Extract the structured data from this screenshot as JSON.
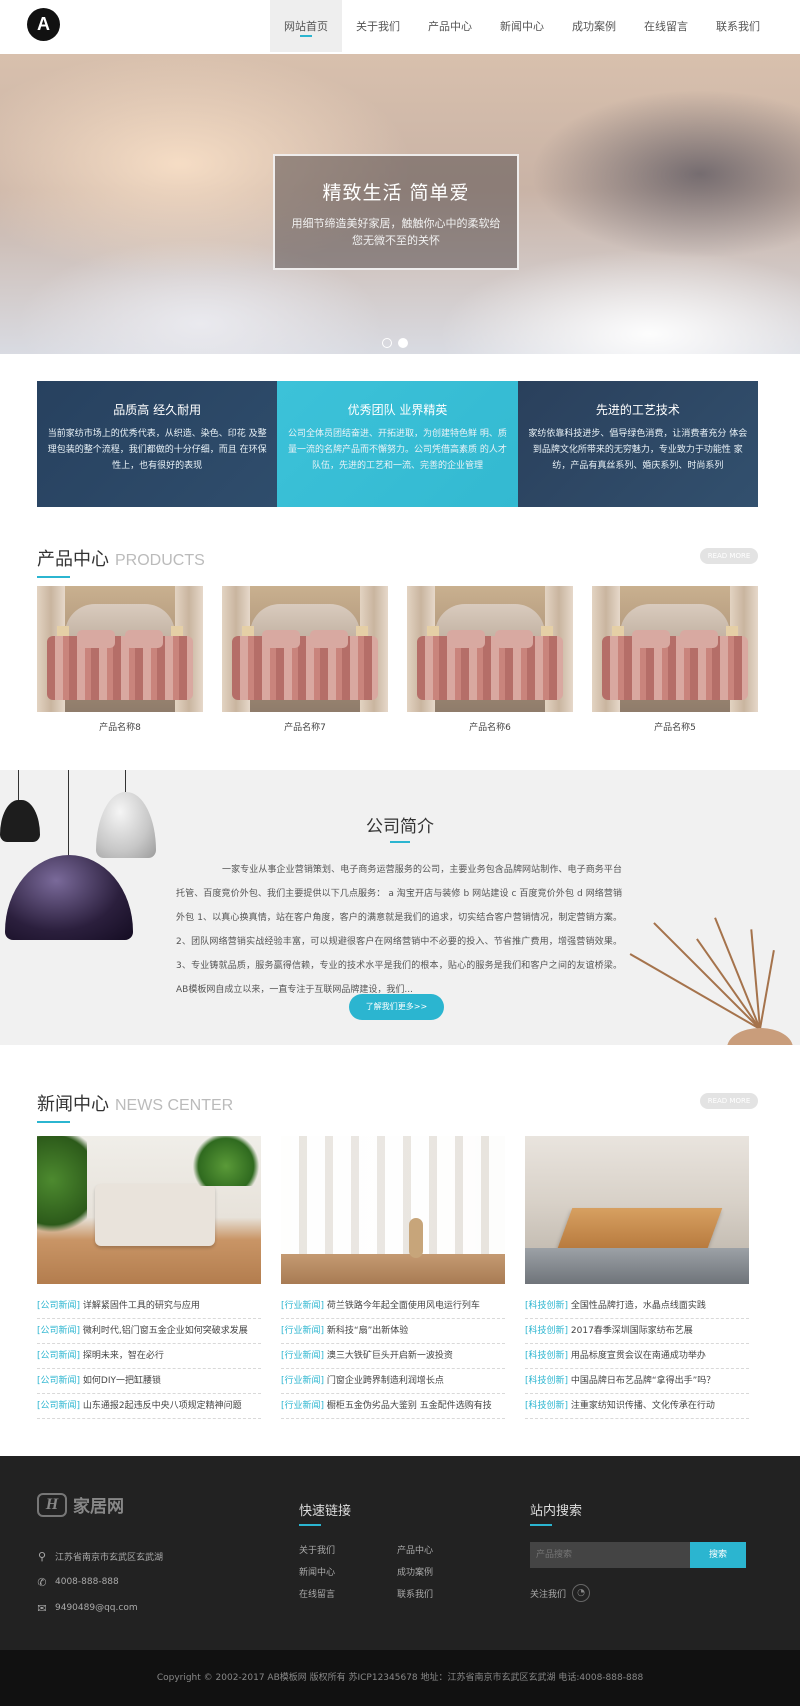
{
  "nav": {
    "items": [
      "网站首页",
      "关于我们",
      "产品中心",
      "新闻中心",
      "成功案例",
      "在线留言",
      "联系我们"
    ],
    "active_index": 0
  },
  "logo": {
    "mark": "A"
  },
  "hero": {
    "title": "精致生活 简单爱",
    "subtitle": "用细节缔造美好家居，触触你心中的柔软给您无微不至的关怀",
    "slides": 2,
    "current_slide": 1
  },
  "features": [
    {
      "title": "品质高 经久耐用",
      "text": "当前家纺市场上的优秀代表，从织造、染色、印花 及整理包装的整个流程，我们都做的十分仔细，而且 在环保性上，也有很好的表现"
    },
    {
      "title": "优秀团队 业界精英",
      "text": "公司全体员团结奋进、开拓进取，为创建特色鲜 明、质量一流的名牌产品而不懈努力。公司凭借高素质 的人才队伍，先进的工艺和一流、完善的企业管理"
    },
    {
      "title": "先进的工艺技术",
      "text": "家纺依靠科技进步、倡导绿色消费，让消费者充分 体会到品牌文化所带来的无穷魅力，专业致力于功能性 家纺，产品有真丝系列、婚庆系列、时尚系列"
    }
  ],
  "products_section": {
    "title": "产品中心",
    "title_en": "PRODUCTS",
    "more": "READ MORE"
  },
  "products": [
    "产品名称8",
    "产品名称7",
    "产品名称6",
    "产品名称5"
  ],
  "about": {
    "title": "公司简介",
    "text": "一家专业从事企业营销策划、电子商务运营服务的公司，主要业务包含品牌网站制作、电子商务平台托管、百度竞价外包、我们主要提供以下几点服务： a 淘宝开店与装修 b 网站建设 c 百度竞价外包 d 网络营销外包 1、以真心换真情，站在客户角度，客户的满意就是我们的追求，切实结合客户营销情况，制定营销方案。 2、团队网络营销实战经验丰富，可以规避很客户在网络营销中不必要的投入、节省推广费用，增强营销效果。 3、专业铸就品质，服务赢得信赖，专业的技术水平是我们的根本，贴心的服务是我们和客户之间的友谊桥梁。 AB模板网自成立以来，一直专注于互联网品牌建设，我们...",
    "button": "了解我们更多>>"
  },
  "news_section": {
    "title": "新闻中心",
    "title_en": "NEWS CENTER",
    "more": "READ MORE"
  },
  "news_columns": [
    {
      "tag": "[公司新闻]",
      "items": [
        "详解紧固件工具的研究与应用",
        "微利时代,铝门窗五金企业如何突破求发展",
        "探明未来，智在必行",
        "如何DIY一把缸腰锁",
        "山东通报2起违反中央八项规定精神问题"
      ]
    },
    {
      "tag": "[行业新闻]",
      "items": [
        "荷兰铁路今年起全面使用风电运行列车",
        "新科技“扇”出新体验",
        "澳三大铁矿巨头开启新一波投资",
        "门窗企业跨界制造利润增长点",
        "橱柜五金伪劣品大鉴别 五金配件选购有技"
      ]
    },
    {
      "tag": "[科技创新]",
      "items": [
        "全国性品牌打造，水晶点线面实践",
        "2017春季深圳国际家纺布艺展",
        "用品标度宣贯会议在南通成功举办",
        "中国品牌日布艺品牌“拿得出手”吗？",
        "注重家纺知识传播、文化传承在行动"
      ]
    }
  ],
  "footer": {
    "brand": "家居网",
    "brand_mark": "H",
    "address": "江苏省南京市玄武区玄武湖",
    "phone": "4008-888-888",
    "email": "9490489@qq.com",
    "links_title": "快速链接",
    "links": [
      "关于我们",
      "产品中心",
      "新闻中心",
      "成功案例",
      "在线留言",
      "联系我们"
    ],
    "search_title": "站内搜索",
    "search_placeholder": "产品搜索",
    "search_button": "搜索",
    "follow": "关注我们",
    "copyright": "Copyright © 2002-2017 AB模板网 版权所有  苏ICP12345678  地址：江苏省南京市玄武区玄武湖  电话:4008-888-888"
  },
  "colors": {
    "accent": "#2bb5d0",
    "navy": "#2a405c",
    "footer": "#222222"
  }
}
